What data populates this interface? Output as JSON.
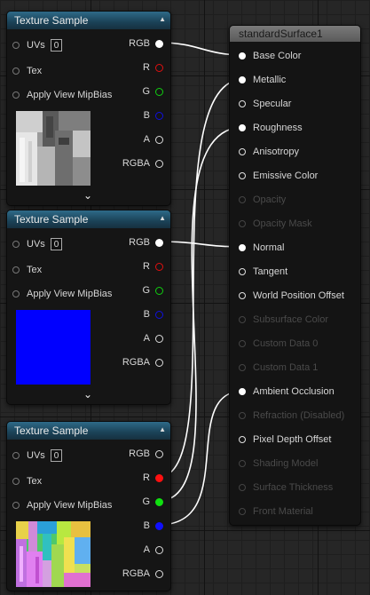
{
  "texture_nodes": [
    {
      "title": "Texture Sample",
      "uvs_label": "UVs",
      "uvs_value": "0",
      "tex_label": "Tex",
      "mip_label": "Apply View MipBias",
      "outputs": [
        "RGB",
        "R",
        "G",
        "B",
        "A",
        "RGBA"
      ],
      "preview": "grayscale-texture"
    },
    {
      "title": "Texture Sample",
      "uvs_label": "UVs",
      "uvs_value": "0",
      "tex_label": "Tex",
      "mip_label": "Apply View MipBias",
      "outputs": [
        "RGB",
        "R",
        "G",
        "B",
        "A",
        "RGBA"
      ],
      "preview": "solid-blue-normal",
      "preview_color": "#0000ff"
    },
    {
      "title": "Texture Sample",
      "uvs_label": "UVs",
      "uvs_value": "0",
      "tex_label": "Tex",
      "mip_label": "Apply View MipBias",
      "outputs": [
        "RGB",
        "R",
        "G",
        "B",
        "A",
        "RGBA"
      ],
      "preview": "packed-orm-texture"
    }
  ],
  "surface_node": {
    "title": "standardSurface1",
    "inputs": [
      "Base Color",
      "Metallic",
      "Specular",
      "Roughness",
      "Anisotropy",
      "Emissive Color",
      "Opacity",
      "Opacity Mask",
      "Normal",
      "Tangent",
      "World Position Offset",
      "Subsurface Color",
      "Custom Data 0",
      "Custom Data 1",
      "Ambient Occlusion",
      "Refraction (Disabled)",
      "Pixel Depth Offset",
      "Shading Model",
      "Surface Thickness",
      "Front Material"
    ]
  },
  "colors": {
    "header_blue": "#1b4257",
    "wire": "#ffffff",
    "pin_red": "#ff1010",
    "pin_green": "#10e010",
    "pin_blue": "#1010ff"
  }
}
